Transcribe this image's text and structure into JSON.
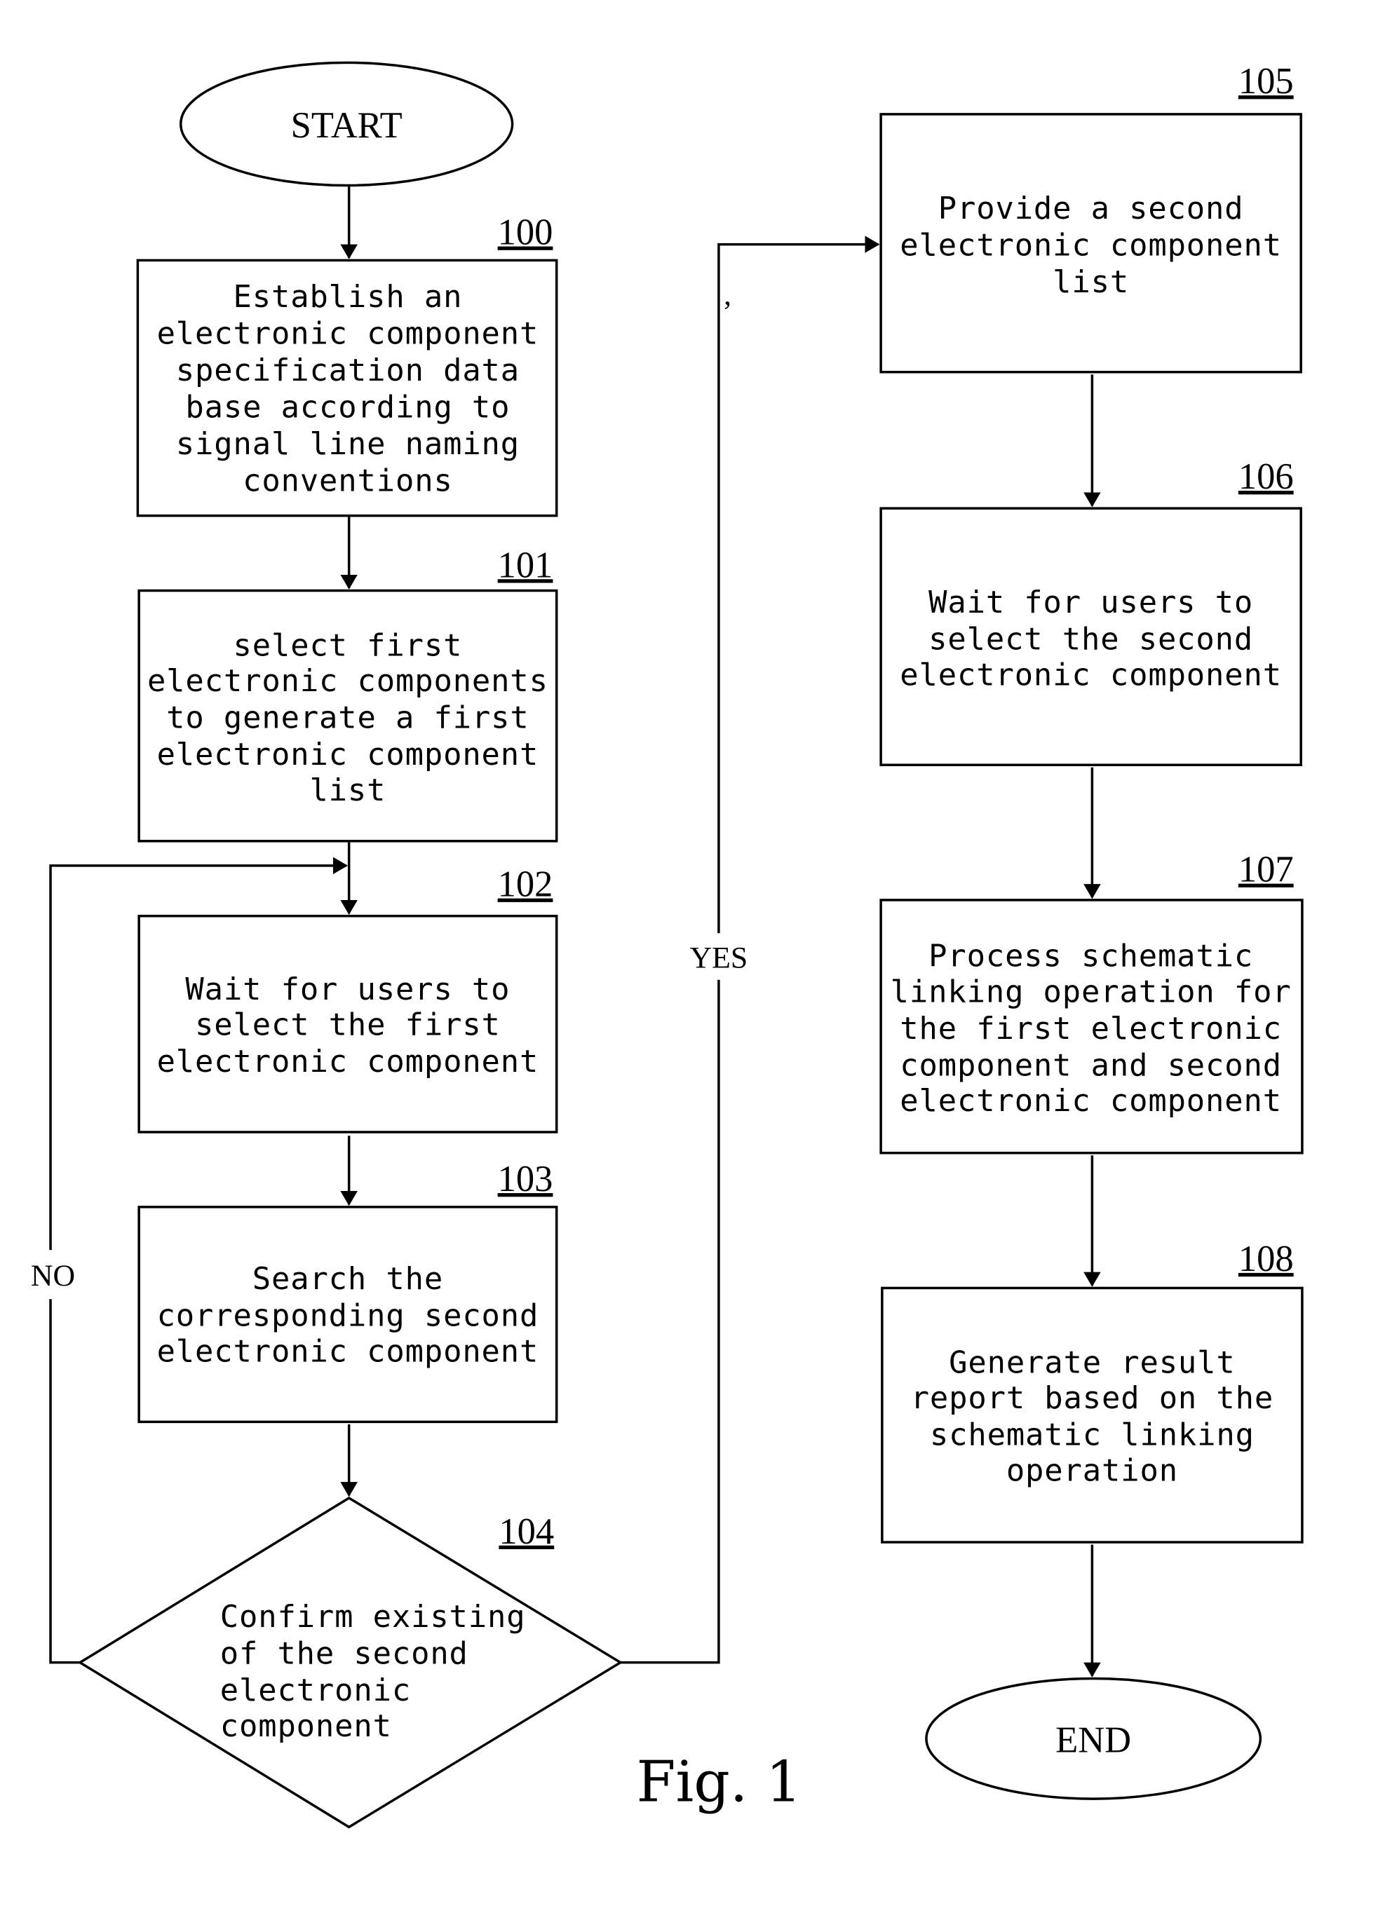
{
  "figure_label": "Fig. 1",
  "start": {
    "label": "START"
  },
  "end": {
    "label": "END"
  },
  "steps": [
    {
      "id": "100",
      "lines": [
        "Establish an",
        "electronic component",
        "specification data",
        "base according to",
        "signal line naming",
        "conventions"
      ]
    },
    {
      "id": "101",
      "lines": [
        "select first",
        "electronic components",
        "to generate a first",
        "electronic component",
        "list"
      ]
    },
    {
      "id": "102",
      "lines": [
        "Wait for users to",
        "select the first",
        "electronic component"
      ]
    },
    {
      "id": "103",
      "lines": [
        "Search the",
        "corresponding second",
        "electronic component"
      ]
    },
    {
      "id": "104",
      "lines": [
        "Confirm existing",
        "of the second",
        "electronic",
        "component"
      ]
    },
    {
      "id": "105",
      "lines": [
        "Provide a second",
        "electronic component",
        "list"
      ]
    },
    {
      "id": "106",
      "lines": [
        "Wait for users to",
        "select the second",
        "electronic component"
      ]
    },
    {
      "id": "107",
      "lines": [
        "Process schematic",
        "linking operation for",
        "the first electronic",
        "component and second",
        "electronic component"
      ]
    },
    {
      "id": "108",
      "lines": [
        "Generate result",
        "report based on the",
        "schematic linking",
        "operation"
      ]
    }
  ],
  "branches": {
    "yes": "YES",
    "no": "NO"
  }
}
